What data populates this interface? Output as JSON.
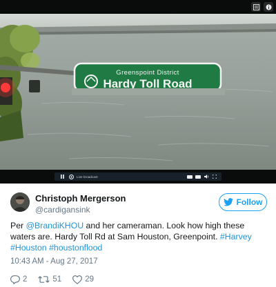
{
  "media": {
    "sign_district": "Greenspoint District",
    "sign_road": "Hardy Toll Road",
    "controls": {
      "live_label": "Live broadcast"
    }
  },
  "author": {
    "name": "Christoph Mergerson",
    "handle": "@cardigansink"
  },
  "follow_button": {
    "label": "Follow",
    "icon": "twitter-bird-icon",
    "color": "#1da1f2"
  },
  "tweet": {
    "text_parts": [
      "Per ",
      "@BrandiKHOU",
      " and her cameraman. Look how high these waters are. Hardy Toll Rd at Sam Houston, Greenpoint. ",
      "#Harvey",
      " ",
      "#Houston",
      " ",
      "#houstonflood"
    ],
    "timestamp": "10:43 AM - Aug 27, 2017",
    "link_color": "#1b95e0"
  },
  "actions": {
    "replies": "2",
    "retweets": "51",
    "likes": "29"
  }
}
